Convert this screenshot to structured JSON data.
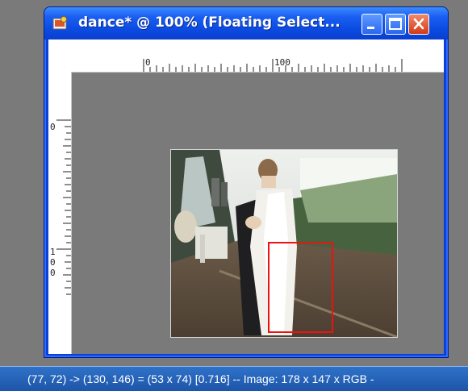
{
  "window": {
    "title": "dance* @ 100% (Floating Select...",
    "buttons": {
      "minimize": "minimize",
      "maximize": "maximize",
      "close": "close"
    }
  },
  "rulers": {
    "top_labels": [
      "0",
      "100"
    ],
    "left_labels": [
      "0",
      "1",
      "0",
      "0"
    ]
  },
  "selection": {
    "color": "#e11111"
  },
  "statusbar": {
    "text": "(77, 72) -> (130, 146) = (53 x 74) [0.716] -- Image:  178 x 147 x RGB -"
  },
  "colors": {
    "titlebar": "#0b4ae0",
    "canvas_bg": "#7a7a7a",
    "statusbar": "#2f72c9"
  }
}
